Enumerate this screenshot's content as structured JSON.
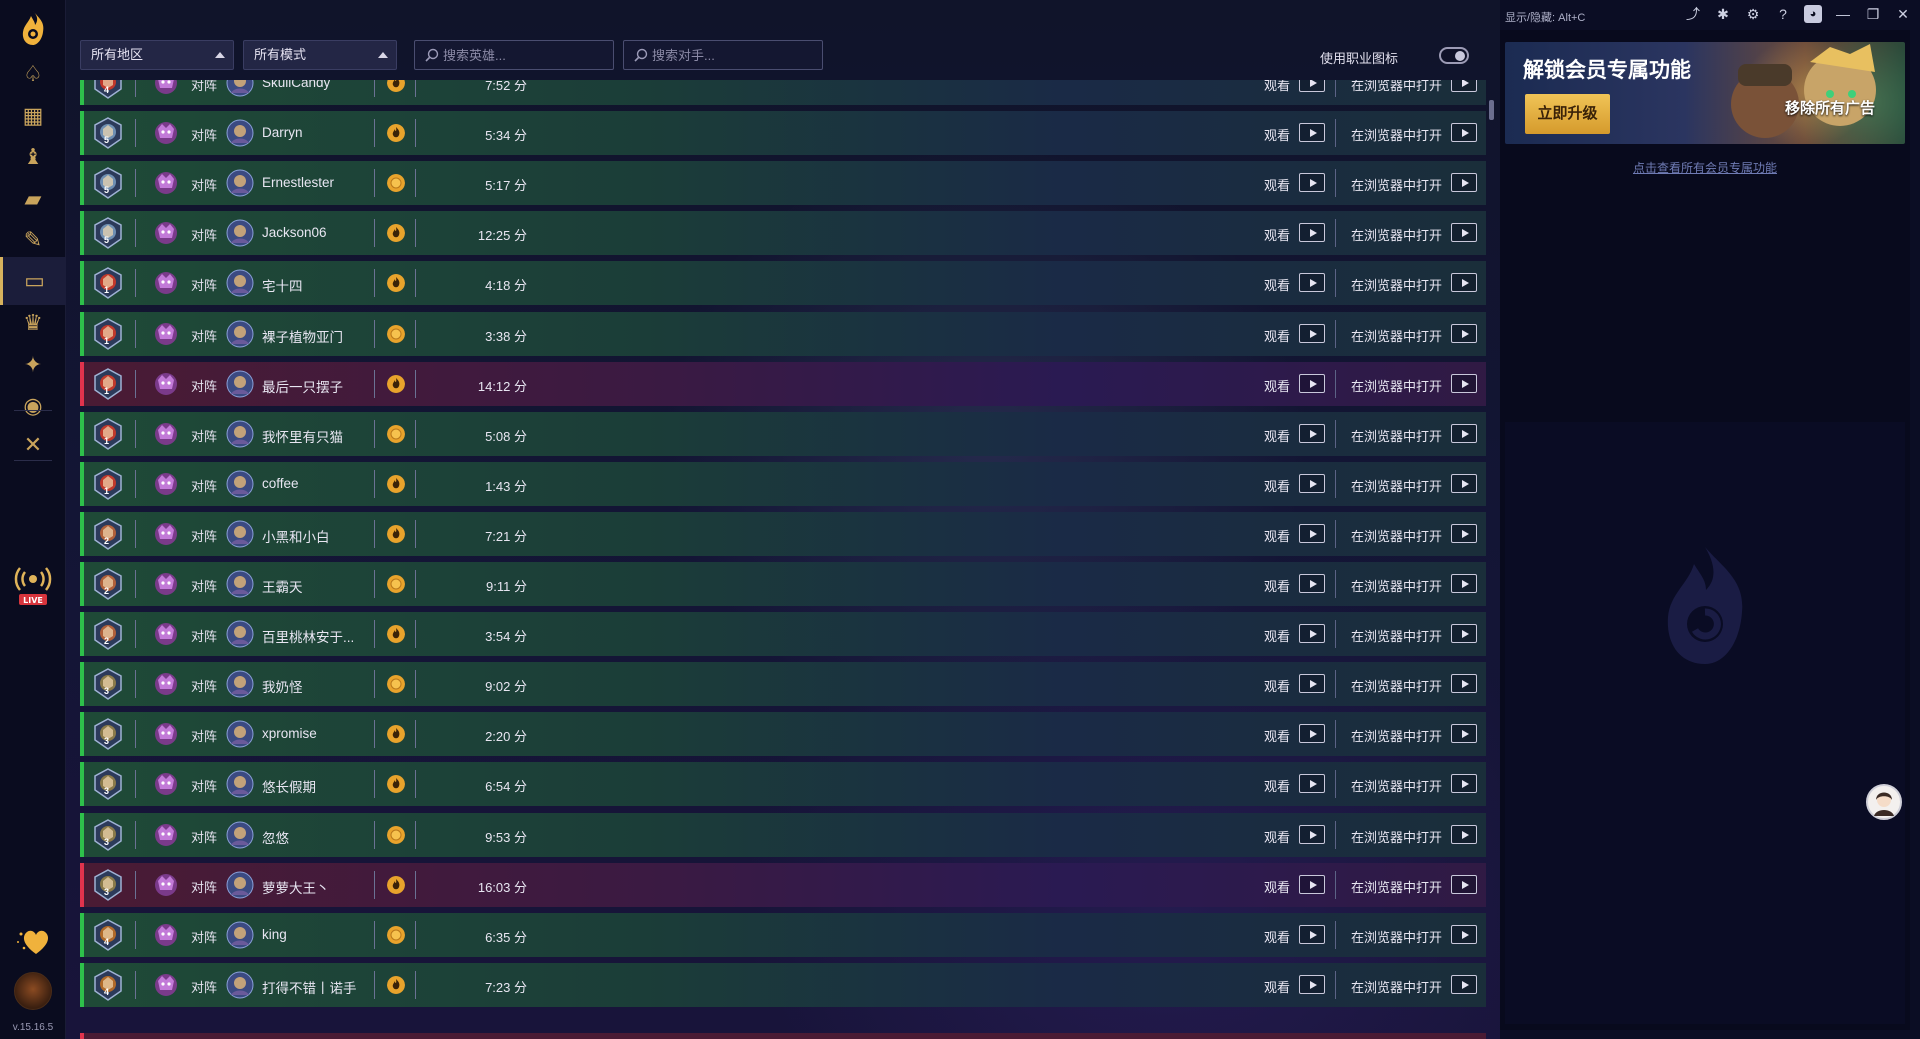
{
  "sidebar": {
    "version": "v.15.16.5",
    "items": [
      {
        "name": "decks-icon"
      },
      {
        "name": "collection-icon"
      },
      {
        "name": "rank-icon"
      },
      {
        "name": "cards-icon"
      },
      {
        "name": "draft-icon"
      },
      {
        "name": "replays-icon"
      },
      {
        "name": "crown-icon"
      },
      {
        "name": "battlegrounds-icon"
      },
      {
        "name": "shield-icon"
      },
      {
        "name": "crossed-swords-icon"
      }
    ],
    "live_label": "LIVE"
  },
  "window": {
    "hotkey_text": "显示/隐藏: Alt+C"
  },
  "filters": {
    "region": "所有地区",
    "mode": "所有模式",
    "hero_search_placeholder": "搜索英雄...",
    "opponent_search_placeholder": "搜索对手...",
    "class_icon_label": "使用职业图标"
  },
  "labels": {
    "vs": "对阵",
    "watch": "观看",
    "open_in_browser": "在浏览器中打开"
  },
  "colors": {
    "win": "#2ec04b",
    "loss": "#e0334d",
    "accent": "#d7b25d"
  },
  "games": [
    {
      "result": "win",
      "rank": "4",
      "rank_color": "#c0392b",
      "opponent": "SkullCandy",
      "coin": "flame",
      "duration": "7:52 分"
    },
    {
      "result": "win",
      "rank": "5",
      "rank_color": "#6f8fb2",
      "opponent": "Darryn",
      "coin": "flame",
      "duration": "5:34 分"
    },
    {
      "result": "win",
      "rank": "5",
      "rank_color": "#6f8fb2",
      "opponent": "Ernestlester",
      "coin": "coin",
      "duration": "5:17 分"
    },
    {
      "result": "win",
      "rank": "5",
      "rank_color": "#6f8fb2",
      "opponent": "Jackson06",
      "coin": "flame",
      "duration": "12:25 分"
    },
    {
      "result": "win",
      "rank": "1",
      "rank_color": "#c0392b",
      "opponent": "宅十四",
      "coin": "flame",
      "duration": "4:18 分"
    },
    {
      "result": "win",
      "rank": "1",
      "rank_color": "#c0392b",
      "opponent": "裸子植物亚门",
      "coin": "coin",
      "duration": "3:38 分"
    },
    {
      "result": "loss",
      "rank": "1",
      "rank_color": "#c0392b",
      "opponent": "最后一只摆子",
      "coin": "flame",
      "duration": "14:12 分"
    },
    {
      "result": "win",
      "rank": "1",
      "rank_color": "#c0392b",
      "opponent": "我怀里有只猫",
      "coin": "coin",
      "duration": "5:08 分"
    },
    {
      "result": "win",
      "rank": "1",
      "rank_color": "#c0392b",
      "opponent": "coffee",
      "coin": "flame",
      "duration": "1:43 分"
    },
    {
      "result": "win",
      "rank": "2",
      "rank_color": "#b0603a",
      "opponent": "小黑和小白",
      "coin": "flame",
      "duration": "7:21 分"
    },
    {
      "result": "win",
      "rank": "2",
      "rank_color": "#b0603a",
      "opponent": "王霸天",
      "coin": "coin",
      "duration": "9:11 分"
    },
    {
      "result": "win",
      "rank": "2",
      "rank_color": "#b0603a",
      "opponent": "百里桃林安于...",
      "coin": "flame",
      "duration": "3:54 分"
    },
    {
      "result": "win",
      "rank": "3",
      "rank_color": "#8a7a4a",
      "opponent": "我奶怪",
      "coin": "coin",
      "duration": "9:02 分"
    },
    {
      "result": "win",
      "rank": "3",
      "rank_color": "#8a7a4a",
      "opponent": "xpromise",
      "coin": "flame",
      "duration": "2:20 分"
    },
    {
      "result": "win",
      "rank": "3",
      "rank_color": "#8a7a4a",
      "opponent": "悠长假期",
      "coin": "flame",
      "duration": "6:54 分"
    },
    {
      "result": "win",
      "rank": "3",
      "rank_color": "#8a7a4a",
      "opponent": "忽悠",
      "coin": "coin",
      "duration": "9:53 分"
    },
    {
      "result": "loss",
      "rank": "3",
      "rank_color": "#8a7a4a",
      "opponent": "萝萝大王丶",
      "coin": "flame",
      "duration": "16:03 分"
    },
    {
      "result": "win",
      "rank": "4",
      "rank_color": "#b06a2a",
      "opponent": "king",
      "coin": "coin",
      "duration": "6:35 分"
    },
    {
      "result": "win",
      "rank": "4",
      "rank_color": "#b06a2a",
      "opponent": "打得不错丨诺手",
      "coin": "flame",
      "duration": "7:23 分"
    }
  ],
  "promo": {
    "title": "解锁会员专属功能",
    "upgrade_button": "立即升级",
    "remove_ads": "移除所有广告",
    "view_all_link": "点击查看所有会员专属功能"
  }
}
